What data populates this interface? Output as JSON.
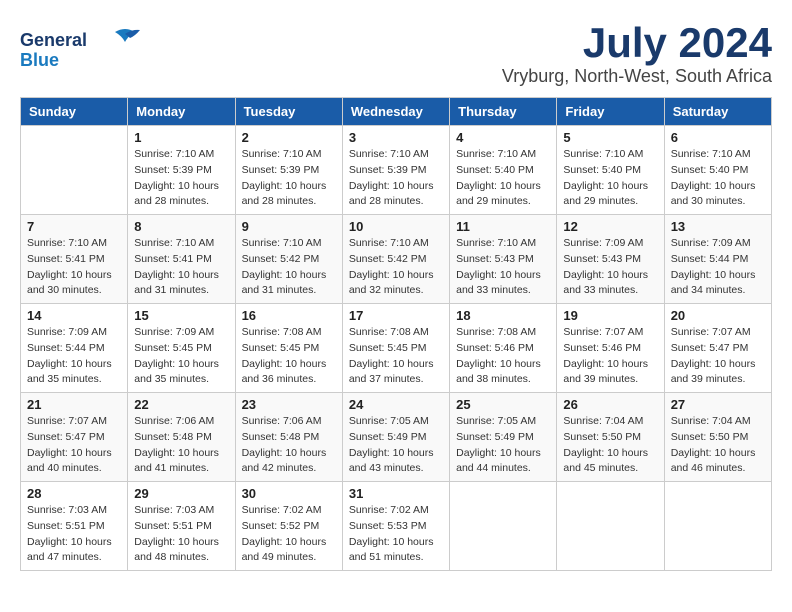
{
  "logo": {
    "text_general": "General",
    "text_blue": "Blue"
  },
  "header": {
    "month_year": "July 2024",
    "location": "Vryburg, North-West, South Africa"
  },
  "weekdays": [
    "Sunday",
    "Monday",
    "Tuesday",
    "Wednesday",
    "Thursday",
    "Friday",
    "Saturday"
  ],
  "weeks": [
    [
      {
        "day": "",
        "data": ""
      },
      {
        "day": "1",
        "data": "Sunrise: 7:10 AM\nSunset: 5:39 PM\nDaylight: 10 hours\nand 28 minutes."
      },
      {
        "day": "2",
        "data": "Sunrise: 7:10 AM\nSunset: 5:39 PM\nDaylight: 10 hours\nand 28 minutes."
      },
      {
        "day": "3",
        "data": "Sunrise: 7:10 AM\nSunset: 5:39 PM\nDaylight: 10 hours\nand 28 minutes."
      },
      {
        "day": "4",
        "data": "Sunrise: 7:10 AM\nSunset: 5:40 PM\nDaylight: 10 hours\nand 29 minutes."
      },
      {
        "day": "5",
        "data": "Sunrise: 7:10 AM\nSunset: 5:40 PM\nDaylight: 10 hours\nand 29 minutes."
      },
      {
        "day": "6",
        "data": "Sunrise: 7:10 AM\nSunset: 5:40 PM\nDaylight: 10 hours\nand 30 minutes."
      }
    ],
    [
      {
        "day": "7",
        "data": "Sunrise: 7:10 AM\nSunset: 5:41 PM\nDaylight: 10 hours\nand 30 minutes."
      },
      {
        "day": "8",
        "data": "Sunrise: 7:10 AM\nSunset: 5:41 PM\nDaylight: 10 hours\nand 31 minutes."
      },
      {
        "day": "9",
        "data": "Sunrise: 7:10 AM\nSunset: 5:42 PM\nDaylight: 10 hours\nand 31 minutes."
      },
      {
        "day": "10",
        "data": "Sunrise: 7:10 AM\nSunset: 5:42 PM\nDaylight: 10 hours\nand 32 minutes."
      },
      {
        "day": "11",
        "data": "Sunrise: 7:10 AM\nSunset: 5:43 PM\nDaylight: 10 hours\nand 33 minutes."
      },
      {
        "day": "12",
        "data": "Sunrise: 7:09 AM\nSunset: 5:43 PM\nDaylight: 10 hours\nand 33 minutes."
      },
      {
        "day": "13",
        "data": "Sunrise: 7:09 AM\nSunset: 5:44 PM\nDaylight: 10 hours\nand 34 minutes."
      }
    ],
    [
      {
        "day": "14",
        "data": "Sunrise: 7:09 AM\nSunset: 5:44 PM\nDaylight: 10 hours\nand 35 minutes."
      },
      {
        "day": "15",
        "data": "Sunrise: 7:09 AM\nSunset: 5:45 PM\nDaylight: 10 hours\nand 35 minutes."
      },
      {
        "day": "16",
        "data": "Sunrise: 7:08 AM\nSunset: 5:45 PM\nDaylight: 10 hours\nand 36 minutes."
      },
      {
        "day": "17",
        "data": "Sunrise: 7:08 AM\nSunset: 5:45 PM\nDaylight: 10 hours\nand 37 minutes."
      },
      {
        "day": "18",
        "data": "Sunrise: 7:08 AM\nSunset: 5:46 PM\nDaylight: 10 hours\nand 38 minutes."
      },
      {
        "day": "19",
        "data": "Sunrise: 7:07 AM\nSunset: 5:46 PM\nDaylight: 10 hours\nand 39 minutes."
      },
      {
        "day": "20",
        "data": "Sunrise: 7:07 AM\nSunset: 5:47 PM\nDaylight: 10 hours\nand 39 minutes."
      }
    ],
    [
      {
        "day": "21",
        "data": "Sunrise: 7:07 AM\nSunset: 5:47 PM\nDaylight: 10 hours\nand 40 minutes."
      },
      {
        "day": "22",
        "data": "Sunrise: 7:06 AM\nSunset: 5:48 PM\nDaylight: 10 hours\nand 41 minutes."
      },
      {
        "day": "23",
        "data": "Sunrise: 7:06 AM\nSunset: 5:48 PM\nDaylight: 10 hours\nand 42 minutes."
      },
      {
        "day": "24",
        "data": "Sunrise: 7:05 AM\nSunset: 5:49 PM\nDaylight: 10 hours\nand 43 minutes."
      },
      {
        "day": "25",
        "data": "Sunrise: 7:05 AM\nSunset: 5:49 PM\nDaylight: 10 hours\nand 44 minutes."
      },
      {
        "day": "26",
        "data": "Sunrise: 7:04 AM\nSunset: 5:50 PM\nDaylight: 10 hours\nand 45 minutes."
      },
      {
        "day": "27",
        "data": "Sunrise: 7:04 AM\nSunset: 5:50 PM\nDaylight: 10 hours\nand 46 minutes."
      }
    ],
    [
      {
        "day": "28",
        "data": "Sunrise: 7:03 AM\nSunset: 5:51 PM\nDaylight: 10 hours\nand 47 minutes."
      },
      {
        "day": "29",
        "data": "Sunrise: 7:03 AM\nSunset: 5:51 PM\nDaylight: 10 hours\nand 48 minutes."
      },
      {
        "day": "30",
        "data": "Sunrise: 7:02 AM\nSunset: 5:52 PM\nDaylight: 10 hours\nand 49 minutes."
      },
      {
        "day": "31",
        "data": "Sunrise: 7:02 AM\nSunset: 5:53 PM\nDaylight: 10 hours\nand 51 minutes."
      },
      {
        "day": "",
        "data": ""
      },
      {
        "day": "",
        "data": ""
      },
      {
        "day": "",
        "data": ""
      }
    ]
  ]
}
